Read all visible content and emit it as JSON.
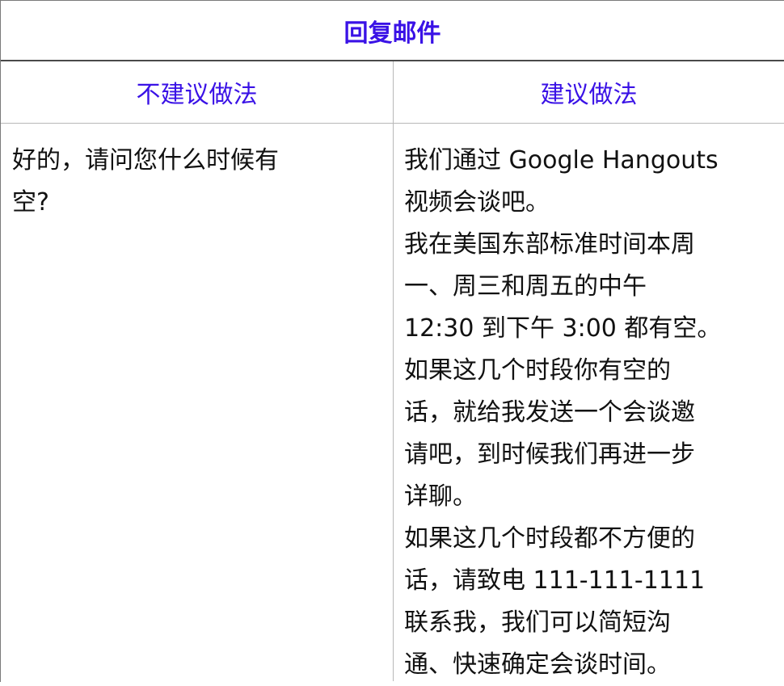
{
  "table": {
    "title": "回复邮件",
    "headers": {
      "not_recommended": "不建议做法",
      "recommended": "建议做法"
    },
    "not_recommended_lines": [
      "好的，请问您什么时候有",
      "空?"
    ],
    "recommended_lines": [
      "我们通过 Google Hangouts",
      "视频会谈吧。",
      "我在美国东部标准时间本周",
      "一、周三和周五的中午",
      "12:30 到下午 3:00 都有空。",
      "如果这几个时段你有空的",
      "话，就给我发送一个会谈邀",
      "请吧，到时候我们再进一步",
      "详聊。",
      "如果这几个时段都不方便的",
      "话，请致电 111-111-1111",
      "联系我，我们可以简短沟",
      "通、快速确定会谈时间。"
    ],
    "colors": {
      "accent": "#3a12e6",
      "text": "#111111",
      "border": "#7a7a7a"
    }
  }
}
